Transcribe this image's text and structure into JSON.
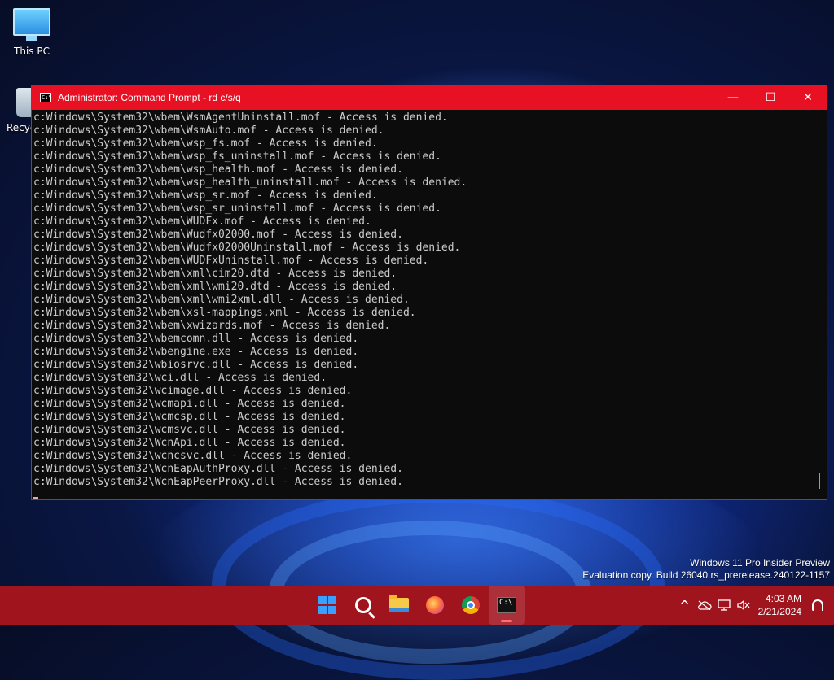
{
  "desktop": {
    "icons": [
      {
        "label": "This PC",
        "icon": "monitor-icon"
      },
      {
        "label": "Recyc",
        "icon": "recycle-bin-icon"
      }
    ]
  },
  "window": {
    "title": "Administrator: Command Prompt - rd  c/s/q",
    "title_icon_text": "C:\\",
    "accent_color": "#e81123",
    "controls": {
      "minimize": "—",
      "maximize": "☐",
      "close": "✕"
    },
    "lines": [
      "c:Windows\\System32\\wbem\\WsmAgentUninstall.mof - Access is denied.",
      "c:Windows\\System32\\wbem\\WsmAuto.mof - Access is denied.",
      "c:Windows\\System32\\wbem\\wsp_fs.mof - Access is denied.",
      "c:Windows\\System32\\wbem\\wsp_fs_uninstall.mof - Access is denied.",
      "c:Windows\\System32\\wbem\\wsp_health.mof - Access is denied.",
      "c:Windows\\System32\\wbem\\wsp_health_uninstall.mof - Access is denied.",
      "c:Windows\\System32\\wbem\\wsp_sr.mof - Access is denied.",
      "c:Windows\\System32\\wbem\\wsp_sr_uninstall.mof - Access is denied.",
      "c:Windows\\System32\\wbem\\WUDFx.mof - Access is denied.",
      "c:Windows\\System32\\wbem\\Wudfx02000.mof - Access is denied.",
      "c:Windows\\System32\\wbem\\Wudfx02000Uninstall.mof - Access is denied.",
      "c:Windows\\System32\\wbem\\WUDFxUninstall.mof - Access is denied.",
      "c:Windows\\System32\\wbem\\xml\\cim20.dtd - Access is denied.",
      "c:Windows\\System32\\wbem\\xml\\wmi20.dtd - Access is denied.",
      "c:Windows\\System32\\wbem\\xml\\wmi2xml.dll - Access is denied.",
      "c:Windows\\System32\\wbem\\xsl-mappings.xml - Access is denied.",
      "c:Windows\\System32\\wbem\\xwizards.mof - Access is denied.",
      "c:Windows\\System32\\wbemcomn.dll - Access is denied.",
      "c:Windows\\System32\\wbengine.exe - Access is denied.",
      "c:Windows\\System32\\wbiosrvc.dll - Access is denied.",
      "c:Windows\\System32\\wci.dll - Access is denied.",
      "c:Windows\\System32\\wcimage.dll - Access is denied.",
      "c:Windows\\System32\\wcmapi.dll - Access is denied.",
      "c:Windows\\System32\\wcmcsp.dll - Access is denied.",
      "c:Windows\\System32\\wcmsvc.dll - Access is denied.",
      "c:Windows\\System32\\WcnApi.dll - Access is denied.",
      "c:Windows\\System32\\wcncsvc.dll - Access is denied.",
      "c:Windows\\System32\\WcnEapAuthProxy.dll - Access is denied.",
      "c:Windows\\System32\\WcnEapPeerProxy.dll - Access is denied."
    ]
  },
  "watermark": {
    "line1": "Windows 11 Pro Insider Preview",
    "line2": "Evaluation copy. Build 26040.rs_prerelease.240122-1157"
  },
  "taskbar": {
    "color": "#a0141e",
    "apps": [
      {
        "name": "start-button",
        "icon": "windows-logo-icon"
      },
      {
        "name": "search-button",
        "icon": "search-icon"
      },
      {
        "name": "file-explorer-button",
        "icon": "folder-icon"
      },
      {
        "name": "firefox-button",
        "icon": "firefox-icon"
      },
      {
        "name": "chrome-button",
        "icon": "chrome-icon"
      },
      {
        "name": "command-prompt-button",
        "icon": "terminal-icon",
        "active": true
      }
    ],
    "tray": {
      "chevron": "^",
      "time": "4:03 AM",
      "date": "2/21/2024"
    }
  }
}
